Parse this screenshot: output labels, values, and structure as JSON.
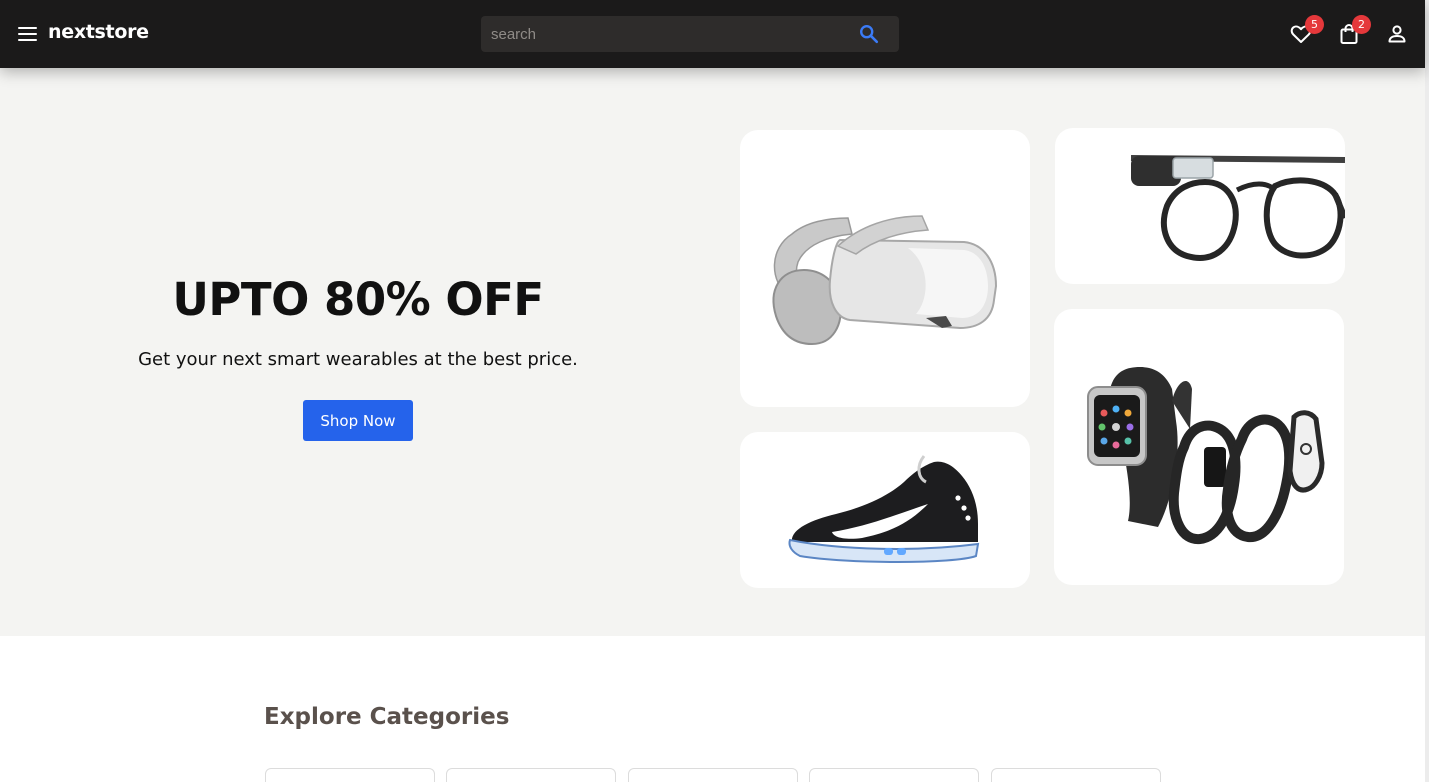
{
  "header": {
    "brand": "nextstore",
    "search": {
      "placeholder": "search",
      "value": ""
    },
    "wishlist_count": "5",
    "cart_count": "2",
    "icons": [
      "menu-icon",
      "search-icon",
      "heart-icon",
      "shopping-bag-icon",
      "user-icon"
    ]
  },
  "hero": {
    "title": "UPTO 80% OFF",
    "subtitle": "Get your next smart wearables at the best price.",
    "cta_label": "Shop Now",
    "products": [
      "vr-headset",
      "smart-glasses",
      "smart-sneaker",
      "smartwatches"
    ]
  },
  "categories": {
    "heading": "Explore Categories",
    "tiles": [
      "",
      "",
      "",
      "",
      ""
    ]
  },
  "colors": {
    "header_bg": "#1b1a1a",
    "accent": "#2563eb",
    "badge": "#e5383b",
    "hero_bg": "#f4f4f2"
  }
}
